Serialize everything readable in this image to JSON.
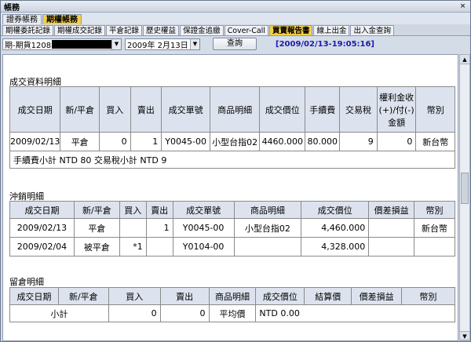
{
  "window": {
    "title": "帳務",
    "close": "×"
  },
  "top_tabs": [
    {
      "label": "證券帳務"
    },
    {
      "label": "期權帳務"
    }
  ],
  "sub_tabs": [
    "期權委託記錄",
    "期權成交記錄",
    "平倉記錄",
    "歷史權益",
    "保證金追繳",
    "Cover-Call",
    "買賣報告書",
    "線上出金",
    "出入金查詢"
  ],
  "toolbar": {
    "account": "期-期貨1208",
    "date": "2009年 2月13日",
    "query_label": "查詢",
    "timestamp": "[2009/02/13-19:05:16]"
  },
  "trade_detail": {
    "title": "成交資料明細",
    "headers": [
      "成交日期",
      "新/平倉",
      "買入",
      "賣出",
      "成交單號",
      "商品明細",
      "成交價位",
      "手續費",
      "交易稅",
      "權利金收(+)/付(-)金額",
      "幣別"
    ],
    "rows": [
      [
        "2009/02/13",
        "平倉",
        "0",
        "1",
        "Y0045-00",
        "小型台指02",
        "4460.000",
        "80.000",
        "9",
        "0",
        "新台幣"
      ]
    ],
    "summary": "手續費小計 NTD 80 交易稅小計 NTD 9"
  },
  "offset_detail": {
    "title": "沖銷明細",
    "headers": [
      "成交日期",
      "新/平倉",
      "買入",
      "賣出",
      "成交單號",
      "商品明細",
      "成交價位",
      "價差損益",
      "幣別"
    ],
    "rows": [
      [
        "2009/02/13",
        "平倉",
        "",
        "1",
        "Y0045-00",
        "小型台指02",
        "4,460.000",
        "",
        "新台幣"
      ],
      [
        "2009/02/04",
        "被平倉",
        "*1",
        "",
        "Y0104-00",
        "",
        "4,328.000",
        "",
        ""
      ]
    ]
  },
  "position_detail": {
    "title": "留倉明細",
    "headers": [
      "成交日期",
      "新/平倉",
      "買入",
      "賣出",
      "商品明細",
      "成交價位",
      "結算價",
      "價差損益",
      "幣別"
    ],
    "subtotal": {
      "label": "小計",
      "buy": "0",
      "sell": "0",
      "avg_label": "平均價",
      "avg_value": "NTD 0.00"
    }
  }
}
